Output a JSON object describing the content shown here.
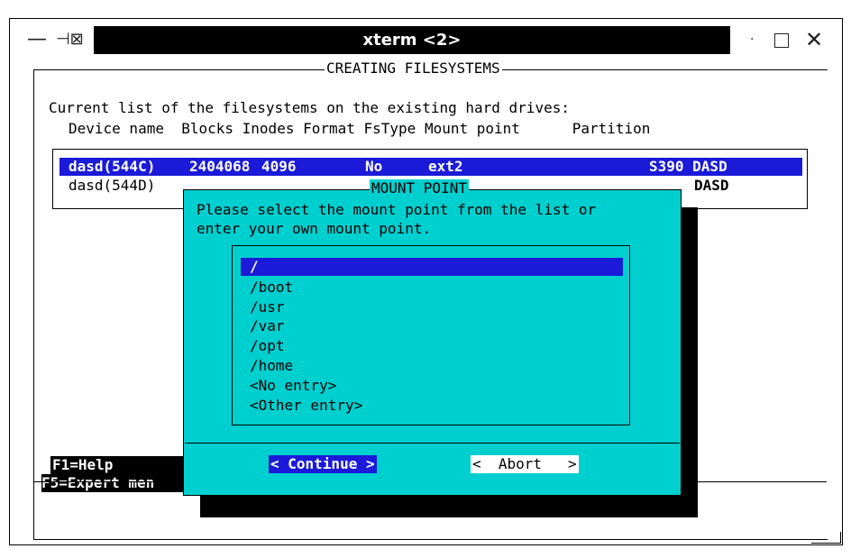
{
  "window": {
    "title": "xterm <2>",
    "menu_icon": "menu-icon",
    "pin_icon": "pin-icon",
    "dot_icon": "minimize-dot-icon",
    "maximize_icon": "maximize-icon",
    "close_icon": "close-icon"
  },
  "screen": {
    "title": "CREATING FILESYSTEMS",
    "intro": "Current list of the filesystems on the existing hard drives:",
    "columns": "Device name  Blocks Inodes Format FsType Mount point      Partition",
    "rows": [
      {
        "device": "dasd(544C)",
        "blocks": "2404068",
        "inodes": "4096",
        "format": "No",
        "fstype": "ext2",
        "partition": "S390 DASD"
      },
      {
        "device": "dasd(544D)",
        "partition": "DASD"
      }
    ],
    "footer": {
      "help": "F1=Help",
      "expert": "F5=Expert men"
    }
  },
  "dialog": {
    "title": "MOUNT POINT",
    "message_line1": "Please select the mount point from the list or",
    "message_line2": "enter your own mount point.",
    "items": [
      "/",
      "/boot",
      "/usr",
      "/var",
      "/opt",
      "/home",
      "<No entry>",
      "<Other entry>"
    ],
    "selected_index": 0,
    "continue_label": "< Continue >",
    "abort_label": "<  Abort   >"
  },
  "colors": {
    "dialog_bg": "#00cfcf",
    "selection": "#1a1ad8"
  }
}
